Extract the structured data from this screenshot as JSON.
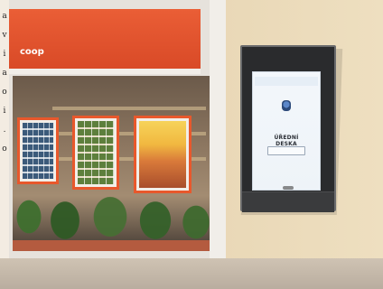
{
  "left_strip_text": "a\nv\ni\na\no\ni\n.\no",
  "storefront": {
    "banner_logo": "coop",
    "banner_subtext": ""
  },
  "kiosk": {
    "screen": {
      "header_logo": "",
      "header_right": "",
      "town_name": "",
      "title": "ÚŘEDNÍ DESKA",
      "button_label": "",
      "small_mark": "",
      "colors": {
        "title": "#2b2f36",
        "logo": "#2b57b8"
      }
    }
  }
}
